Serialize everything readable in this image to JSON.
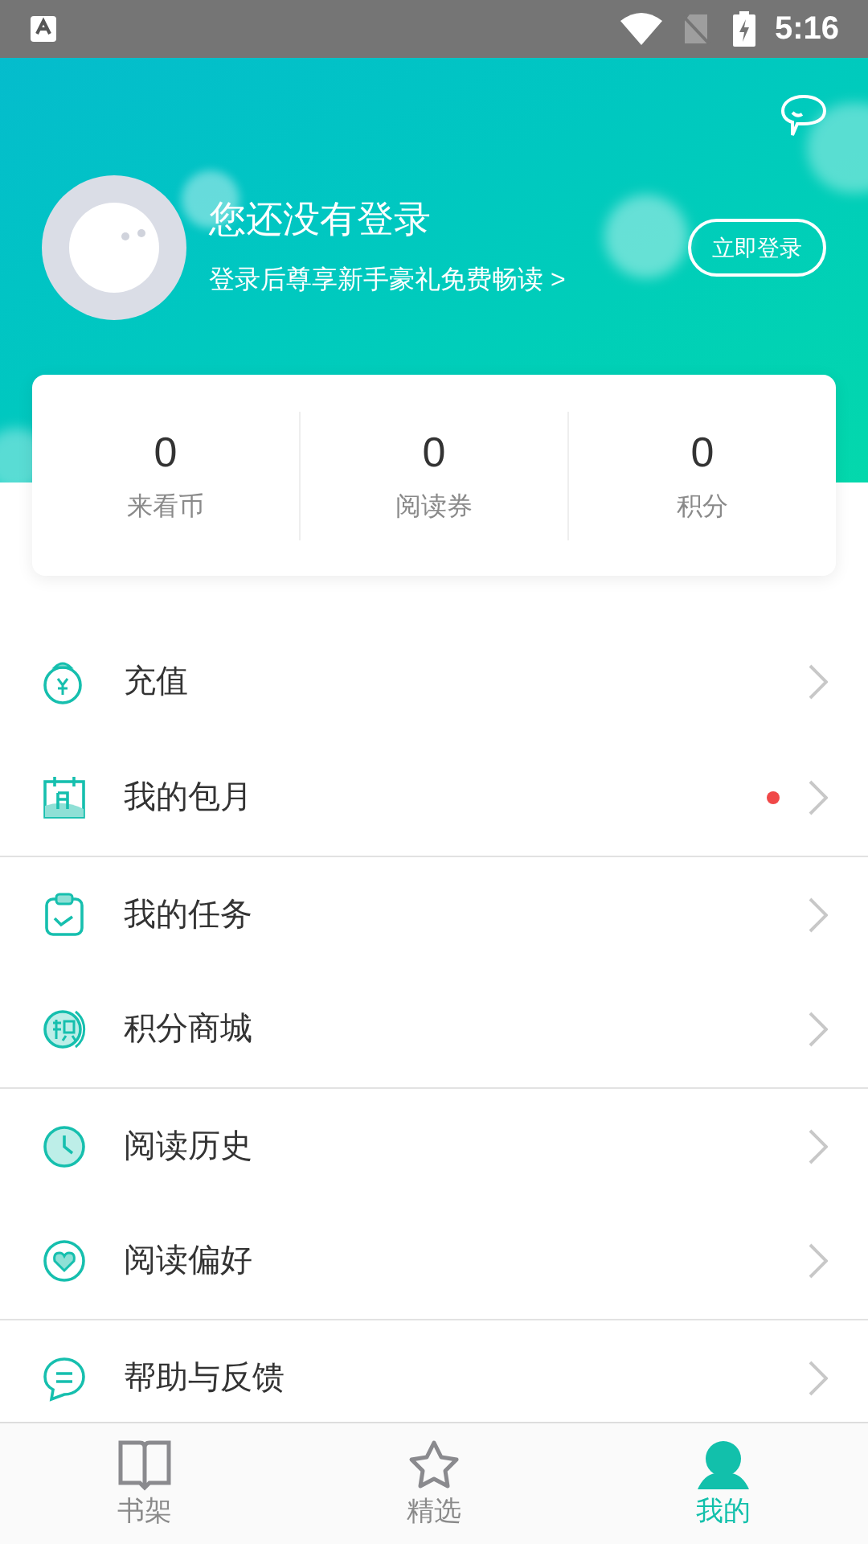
{
  "status_bar": {
    "time": "5:16"
  },
  "header": {
    "title": "您还没有登录",
    "subtitle": "登录后尊享新手豪礼免费畅读 >",
    "login_button": "立即登录"
  },
  "stats": [
    {
      "value": "0",
      "label": "来看币"
    },
    {
      "value": "0",
      "label": "阅读券"
    },
    {
      "value": "0",
      "label": "积分"
    }
  ],
  "menu": [
    {
      "kind": "recharge",
      "label": "充值",
      "badge": false,
      "divider_above": false
    },
    {
      "kind": "monthly",
      "label": "我的包月",
      "badge": true,
      "divider_above": false
    },
    {
      "kind": "tasks",
      "label": "我的任务",
      "badge": false,
      "divider_above": true
    },
    {
      "kind": "points",
      "label": "积分商城",
      "badge": false,
      "divider_above": false
    },
    {
      "kind": "history",
      "label": "阅读历史",
      "badge": false,
      "divider_above": true
    },
    {
      "kind": "preference",
      "label": "阅读偏好",
      "badge": false,
      "divider_above": false
    },
    {
      "kind": "help",
      "label": "帮助与反馈",
      "badge": false,
      "divider_above": true
    }
  ],
  "bottom_nav": [
    {
      "kind": "book",
      "label": "书架",
      "selected": false
    },
    {
      "kind": "star",
      "label": "精选",
      "selected": false
    },
    {
      "kind": "person",
      "label": "我的",
      "selected": true
    }
  ]
}
